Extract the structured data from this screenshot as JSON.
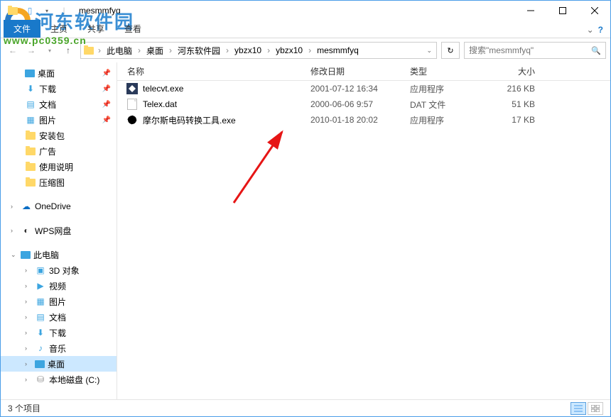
{
  "window": {
    "title": "mesmmfyq"
  },
  "ribbon": {
    "file": "文件",
    "home": "主页",
    "share": "共享",
    "view": "查看"
  },
  "breadcrumb": {
    "items": [
      "此电脑",
      "桌面",
      "河东软件园",
      "ybzx10",
      "ybzx10",
      "mesmmfyq"
    ]
  },
  "search": {
    "placeholder": "搜索\"mesmmfyq\""
  },
  "sidebar": {
    "items": [
      {
        "label": "桌面",
        "icon": "desktop",
        "pin": true
      },
      {
        "label": "下载",
        "icon": "download",
        "pin": true
      },
      {
        "label": "文档",
        "icon": "document",
        "pin": true
      },
      {
        "label": "图片",
        "icon": "picture",
        "pin": true
      },
      {
        "label": "安装包",
        "icon": "folder"
      },
      {
        "label": "广告",
        "icon": "folder"
      },
      {
        "label": "使用说明",
        "icon": "folder"
      },
      {
        "label": "压缩图",
        "icon": "folder"
      }
    ],
    "onedrive": "OneDrive",
    "wps": "WPS网盘",
    "thispc": "此电脑",
    "pc_children": [
      {
        "label": "3D 对象",
        "icon": "3d"
      },
      {
        "label": "视频",
        "icon": "video"
      },
      {
        "label": "图片",
        "icon": "picture"
      },
      {
        "label": "文档",
        "icon": "document"
      },
      {
        "label": "下载",
        "icon": "download"
      },
      {
        "label": "音乐",
        "icon": "music"
      },
      {
        "label": "桌面",
        "icon": "desktop",
        "selected": true
      },
      {
        "label": "本地磁盘 (C:)",
        "icon": "disk"
      }
    ]
  },
  "columns": {
    "name": "名称",
    "date": "修改日期",
    "type": "类型",
    "size": "大小"
  },
  "files": [
    {
      "name": "telecvt.exe",
      "date": "2001-07-12 16:34",
      "type": "应用程序",
      "size": "216 KB",
      "icon": "exe1"
    },
    {
      "name": "Telex.dat",
      "date": "2000-06-06 9:57",
      "type": "DAT 文件",
      "size": "51 KB",
      "icon": "dat"
    },
    {
      "name": "摩尔斯电码转换工具.exe",
      "date": "2010-01-18 20:02",
      "type": "应用程序",
      "size": "17 KB",
      "icon": "exe2"
    }
  ],
  "status": {
    "count": "3 个项目"
  },
  "watermark": {
    "text": "河东软件园",
    "url": "www.pc0359.cn"
  }
}
